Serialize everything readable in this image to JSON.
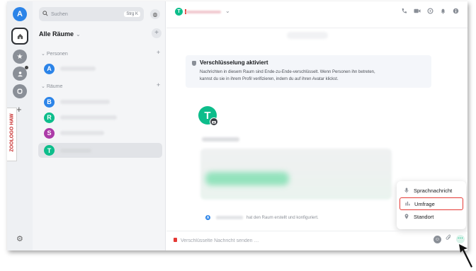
{
  "spacebar": {
    "avatar_letter": "A",
    "side_tag_label": "ZOOLOGO HAW"
  },
  "roomlist": {
    "search_placeholder": "Suchen",
    "search_shortcut": "Strg K",
    "title": "Alle Räume",
    "title_chevron": "⌄",
    "sections": {
      "people": "Personen",
      "rooms": "Räume"
    },
    "people": [
      {
        "letter": "A",
        "color": "#2c84e8"
      }
    ],
    "rooms": [
      {
        "letter": "B",
        "color": "#2c84e8"
      },
      {
        "letter": "R",
        "color": "#0dbd8b"
      },
      {
        "letter": "S",
        "color": "#ac3ba8"
      },
      {
        "letter": "T",
        "color": "#0dbd8b",
        "selected": true
      }
    ]
  },
  "header": {
    "avatar_letter": "T",
    "chevron": "⌄"
  },
  "timeline": {
    "encryption_title": "Verschlüsselung aktiviert",
    "encryption_line1": "Nachrichten in diesem Raum sind Ende-zu-Ende-verschlüsselt. Wenn Personen ihn betreten,",
    "encryption_line2": "kannst du sie in ihrem Profil verifizieren, indem du auf ihren Avatar klickst.",
    "room_avatar_letter": "T",
    "created_avatar_letter": "A",
    "created_text": "hat den Raum erstellt und konfiguriert."
  },
  "composer": {
    "placeholder": "Verschlüsselte Nachricht senden …",
    "more_label": "···"
  },
  "menu": {
    "items": [
      {
        "label": "Sprachnachricht",
        "icon": "microphone-icon"
      },
      {
        "label": "Umfrage",
        "icon": "poll-icon",
        "highlighted": true
      },
      {
        "label": "Standort",
        "icon": "location-pin-icon"
      }
    ]
  },
  "colors": {
    "accent": "#0dbd8b",
    "highlight": "#e53935"
  }
}
